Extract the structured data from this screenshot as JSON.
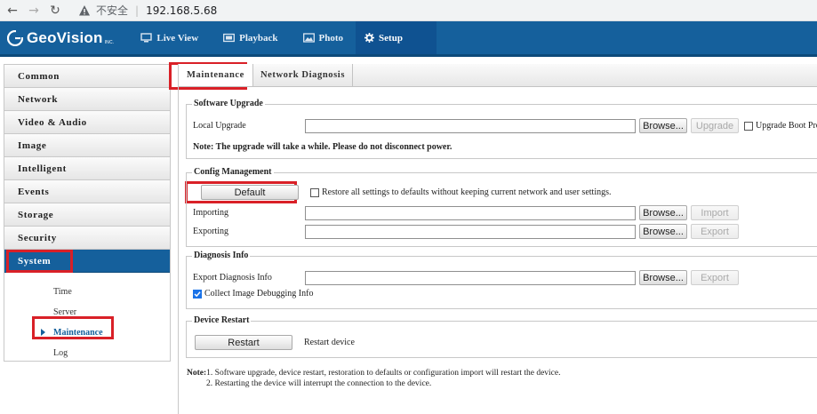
{
  "browser": {
    "insecure_label": "不安全",
    "separator": "|",
    "url": "192.168.5.68"
  },
  "header": {
    "brand": "GeoVision",
    "brand_sub": "INC.",
    "tabs": [
      {
        "label": "Live View",
        "icon": "monitor-icon"
      },
      {
        "label": "Playback",
        "icon": "film-icon"
      },
      {
        "label": "Photo",
        "icon": "photo-icon"
      },
      {
        "label": "Setup",
        "icon": "gear-icon",
        "active": true
      }
    ]
  },
  "sidebar": {
    "items": [
      "Common",
      "Network",
      "Video & Audio",
      "Image",
      "Intelligent",
      "Events",
      "Storage",
      "Security",
      "System"
    ],
    "active": "System",
    "sub_items": [
      "Time",
      "Server",
      "Maintenance",
      "Log"
    ],
    "active_sub": "Maintenance"
  },
  "subtabs": [
    "Maintenance",
    "Network Diagnosis"
  ],
  "software_upgrade": {
    "title": "Software Upgrade",
    "local_upgrade_label": "Local Upgrade",
    "browse_label": "Browse...",
    "upgrade_label": "Upgrade",
    "boot_program_label": "Upgrade Boot Prog",
    "note": "Note: The upgrade will take a while. Please do not disconnect power."
  },
  "config": {
    "title": "Config Management",
    "default_label": "Default",
    "restore_label": "Restore all settings to defaults without keeping current network and user settings.",
    "importing_label": "Importing",
    "exporting_label": "Exporting",
    "browse_label": "Browse...",
    "import_label": "Import",
    "export_label": "Export"
  },
  "diagnosis": {
    "title": "Diagnosis Info",
    "export_label": "Export Diagnosis Info",
    "browse_label": "Browse...",
    "export_button": "Export",
    "collect_label": "Collect Image Debugging Info",
    "collect_checked": true
  },
  "restart": {
    "title": "Device Restart",
    "button": "Restart",
    "desc": "Restart device"
  },
  "footer_note": {
    "prefix": "Note:",
    "line1": "1. Software upgrade, device restart, restoration to defaults or configuration import will restart the device.",
    "line2": "2. Restarting the device will interrupt the connection to the device."
  },
  "colors": {
    "header_blue": "#15609c",
    "highlight_red": "#d92027"
  }
}
